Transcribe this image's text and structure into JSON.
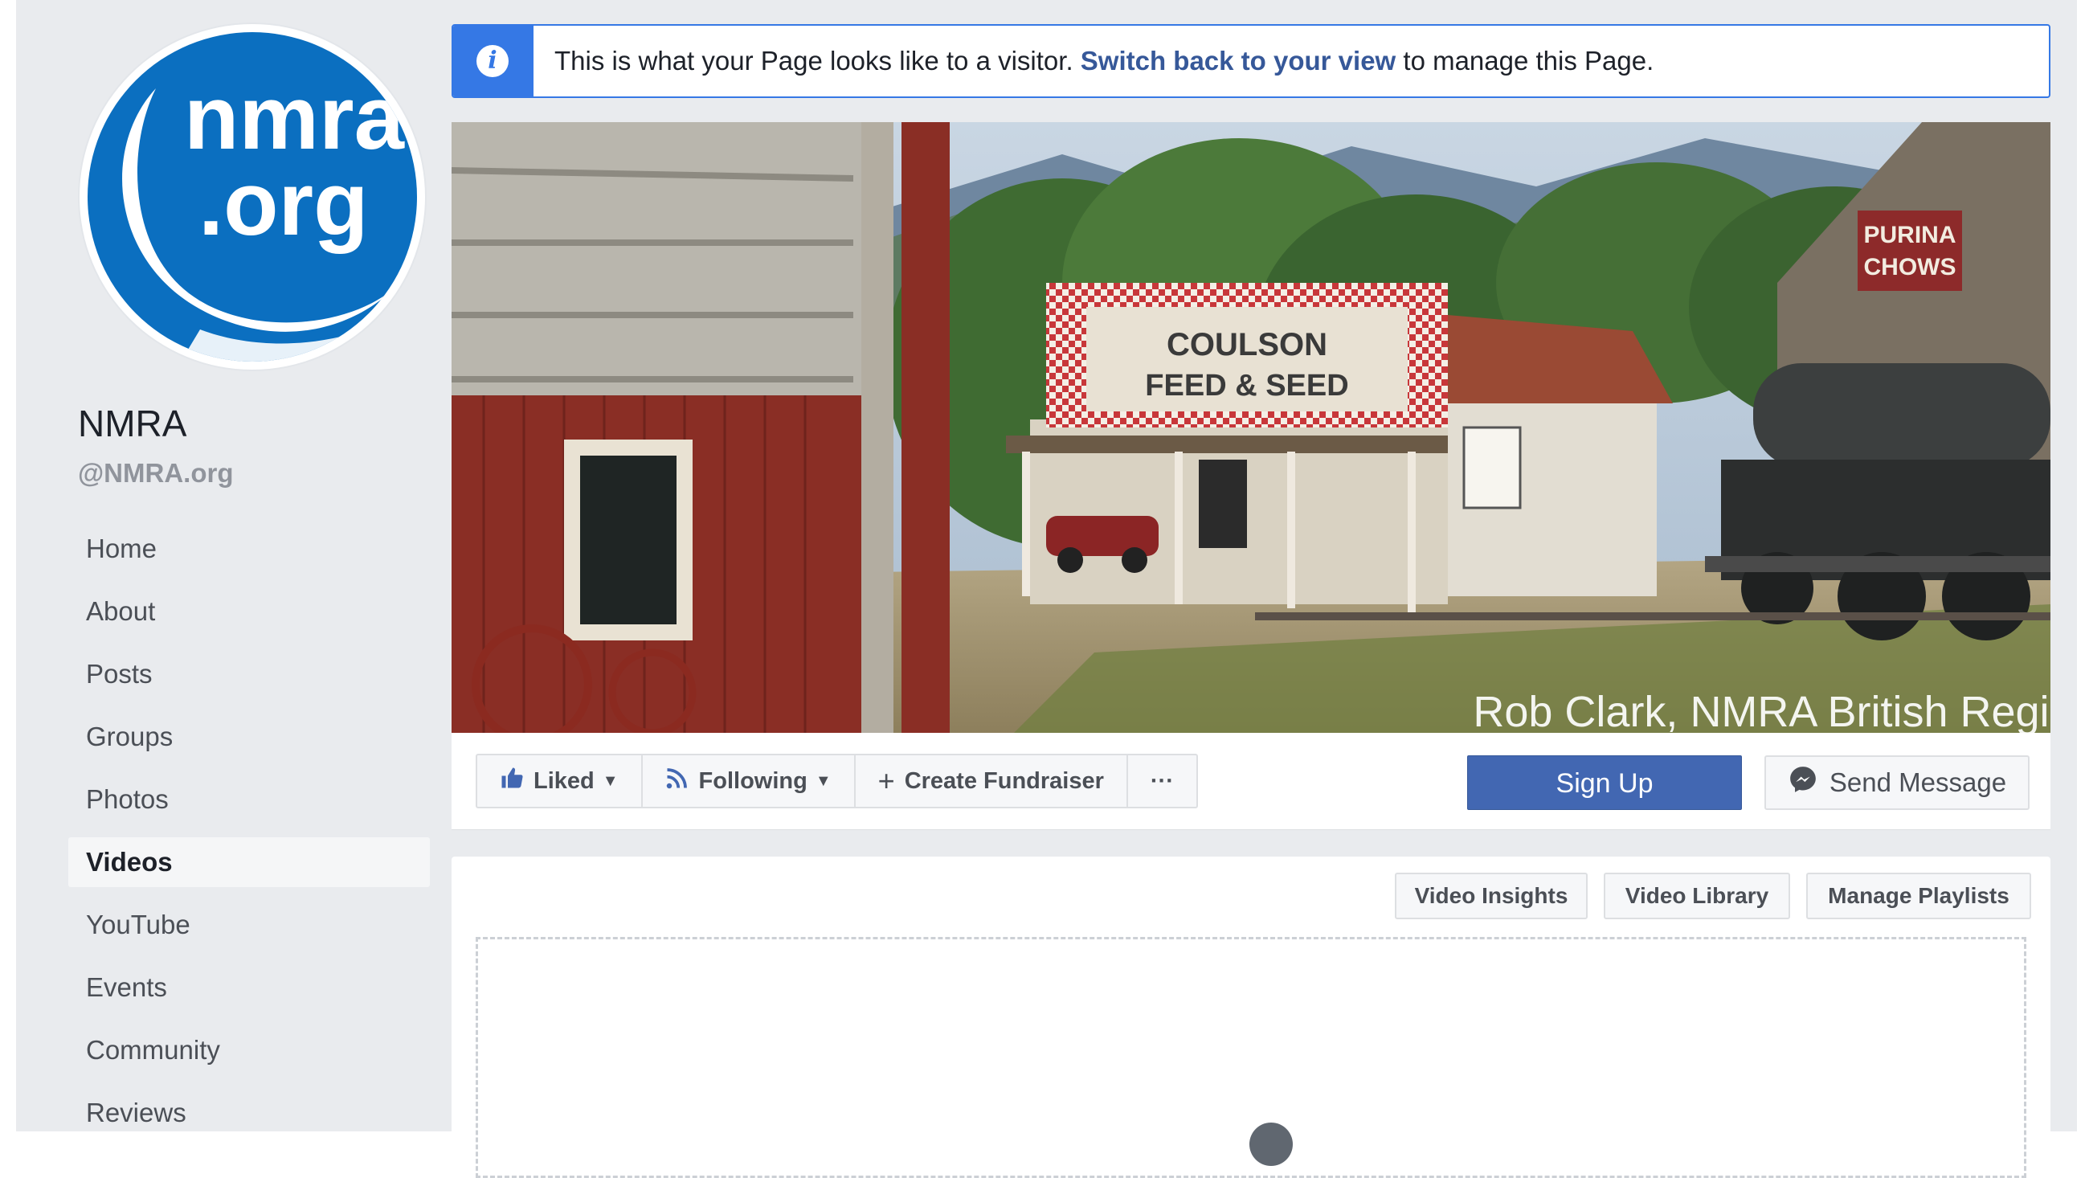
{
  "page": {
    "name": "NMRA",
    "handle": "@NMRA.org",
    "logo_text_line1": "nmra",
    "logo_text_line2": ".org"
  },
  "nav": {
    "items": [
      {
        "label": "Home"
      },
      {
        "label": "About"
      },
      {
        "label": "Posts"
      },
      {
        "label": "Groups"
      },
      {
        "label": "Photos"
      },
      {
        "label": "Videos",
        "active": true
      },
      {
        "label": "YouTube"
      },
      {
        "label": "Events"
      },
      {
        "label": "Community"
      },
      {
        "label": "Reviews"
      }
    ]
  },
  "banner": {
    "icon": "info-icon",
    "text_before": "This is what your Page looks like to a visitor. ",
    "link_text": "Switch back to your view",
    "text_after": " to manage this Page."
  },
  "cover": {
    "caption": "Rob Clark, NMRA British Region",
    "sign_line1": "COULSON",
    "sign_line2": "FEED & SEED",
    "sign2_line1": "PURINA",
    "sign2_line2": "CHOWS"
  },
  "actions": {
    "liked_label": "Liked",
    "following_label": "Following",
    "fundraiser_label": "Create Fundraiser",
    "more_label": "···",
    "signup_label": "Sign Up",
    "message_label": "Send Message"
  },
  "videos": {
    "insights_label": "Video Insights",
    "library_label": "Video Library",
    "playlists_label": "Manage Playlists"
  },
  "colors": {
    "brand_blue": "#4267b2",
    "link_blue": "#365899",
    "banner_blue": "#3578e5",
    "logo_blue": "#0b6fc0"
  }
}
